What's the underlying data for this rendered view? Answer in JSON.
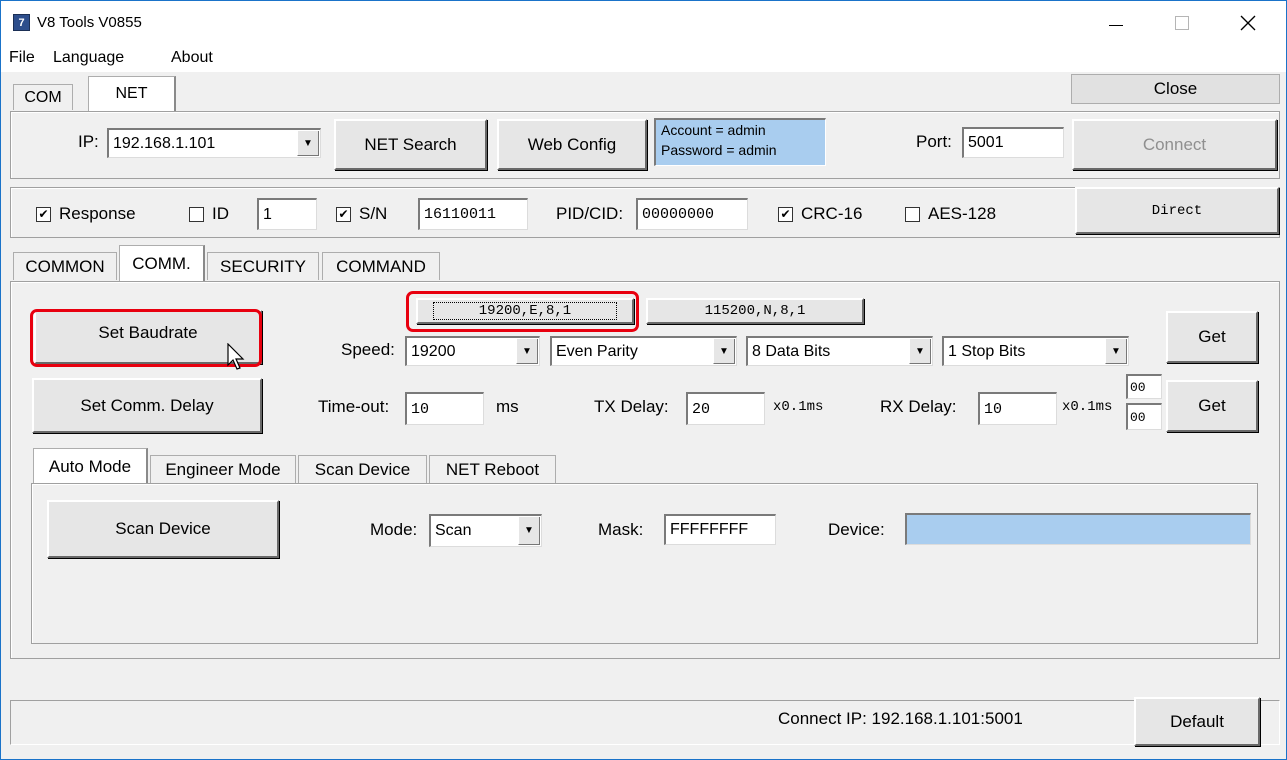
{
  "window": {
    "title": "V8 Tools V0855"
  },
  "menu": {
    "file": "File",
    "language": "Language",
    "about": "About"
  },
  "top_tabs": {
    "com": "COM",
    "net": "NET"
  },
  "close_label": "Close",
  "net": {
    "ip_label": "IP:",
    "ip_value": "192.168.1.101",
    "net_search": "NET Search",
    "web_config": "Web Config",
    "account_line": "Account = admin",
    "password_line": "Password = admin",
    "port_label": "Port:",
    "port_value": "5001",
    "connect": "Connect"
  },
  "options": {
    "response": "Response",
    "id_label": "ID",
    "id_value": "1",
    "sn_label": "S/N",
    "sn_value": "16110011",
    "pidcid_label": "PID/CID:",
    "pidcid_value": "00000000",
    "crc": "CRC-16",
    "aes": "AES-128",
    "direct": "Direct",
    "response_checked": true,
    "id_checked": false,
    "sn_checked": true,
    "crc_checked": true,
    "aes_checked": false
  },
  "main_tabs": {
    "common": "COMMON",
    "comm": "COMM.",
    "security": "SECURITY",
    "command": "COMMAND"
  },
  "comm": {
    "preset1": "19200,E,8,1",
    "preset2": "115200,N,8,1",
    "set_baudrate": "Set Baudrate",
    "speed_label": "Speed:",
    "speed_value": "19200",
    "parity_value": "Even Parity",
    "databits_value": "8 Data Bits",
    "stopbits_value": "1 Stop Bits",
    "get1": "Get",
    "set_comm_delay": "Set Comm. Delay",
    "timeout_label": "Time-out:",
    "timeout_value": "10",
    "ms_unit": "ms",
    "txdelay_label": "TX Delay:",
    "txdelay_value": "20",
    "tx_unit": "x0.1ms",
    "rxdelay_label": "RX Delay:",
    "rxdelay_value": "10",
    "rx_unit": "x0.1ms",
    "small_top": "00",
    "small_bottom": "00",
    "get2": "Get"
  },
  "sub_tabs": {
    "auto": "Auto Mode",
    "engineer": "Engineer Mode",
    "scan": "Scan Device",
    "reboot": "NET Reboot"
  },
  "auto": {
    "scan_device": "Scan Device",
    "mode_label": "Mode:",
    "mode_value": "Scan",
    "mask_label": "Mask:",
    "mask_value": "FFFFFFFF",
    "device_label": "Device:",
    "device_value": ""
  },
  "status": {
    "connect_ip": "Connect IP: 192.168.1.101:5001",
    "default": "Default"
  },
  "colors": {
    "highlight": "#e8000f",
    "account_bg": "#a9cdef",
    "device_bg": "#a9cdef"
  }
}
